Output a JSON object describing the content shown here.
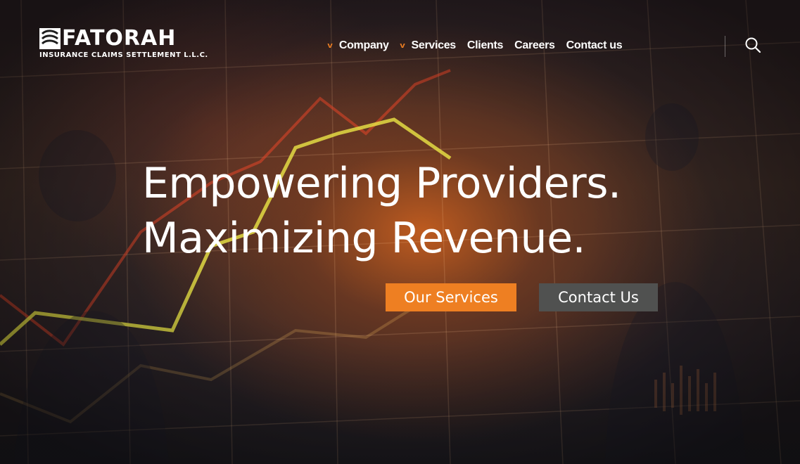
{
  "brand": {
    "name": "FATORAH",
    "tagline": "INSURANCE CLAIMS SETTLEMENT L.L.C."
  },
  "nav": {
    "items": [
      {
        "label": "Company",
        "has_dropdown": true
      },
      {
        "label": "Services",
        "has_dropdown": true
      },
      {
        "label": "Clients",
        "has_dropdown": false
      },
      {
        "label": "Careers",
        "has_dropdown": false
      },
      {
        "label": "Contact us",
        "has_dropdown": false
      }
    ],
    "dropdown_icon": "chevron-down-icon",
    "search_icon": "search-icon"
  },
  "hero": {
    "headline_line1": "Empowering Providers.",
    "headline_line2": "Maximizing Revenue.",
    "primary_button": "Our Services",
    "secondary_button": "Contact Us"
  },
  "colors": {
    "accent": "#ee7f22",
    "secondary_button": "#505150",
    "text": "#ffffff"
  }
}
